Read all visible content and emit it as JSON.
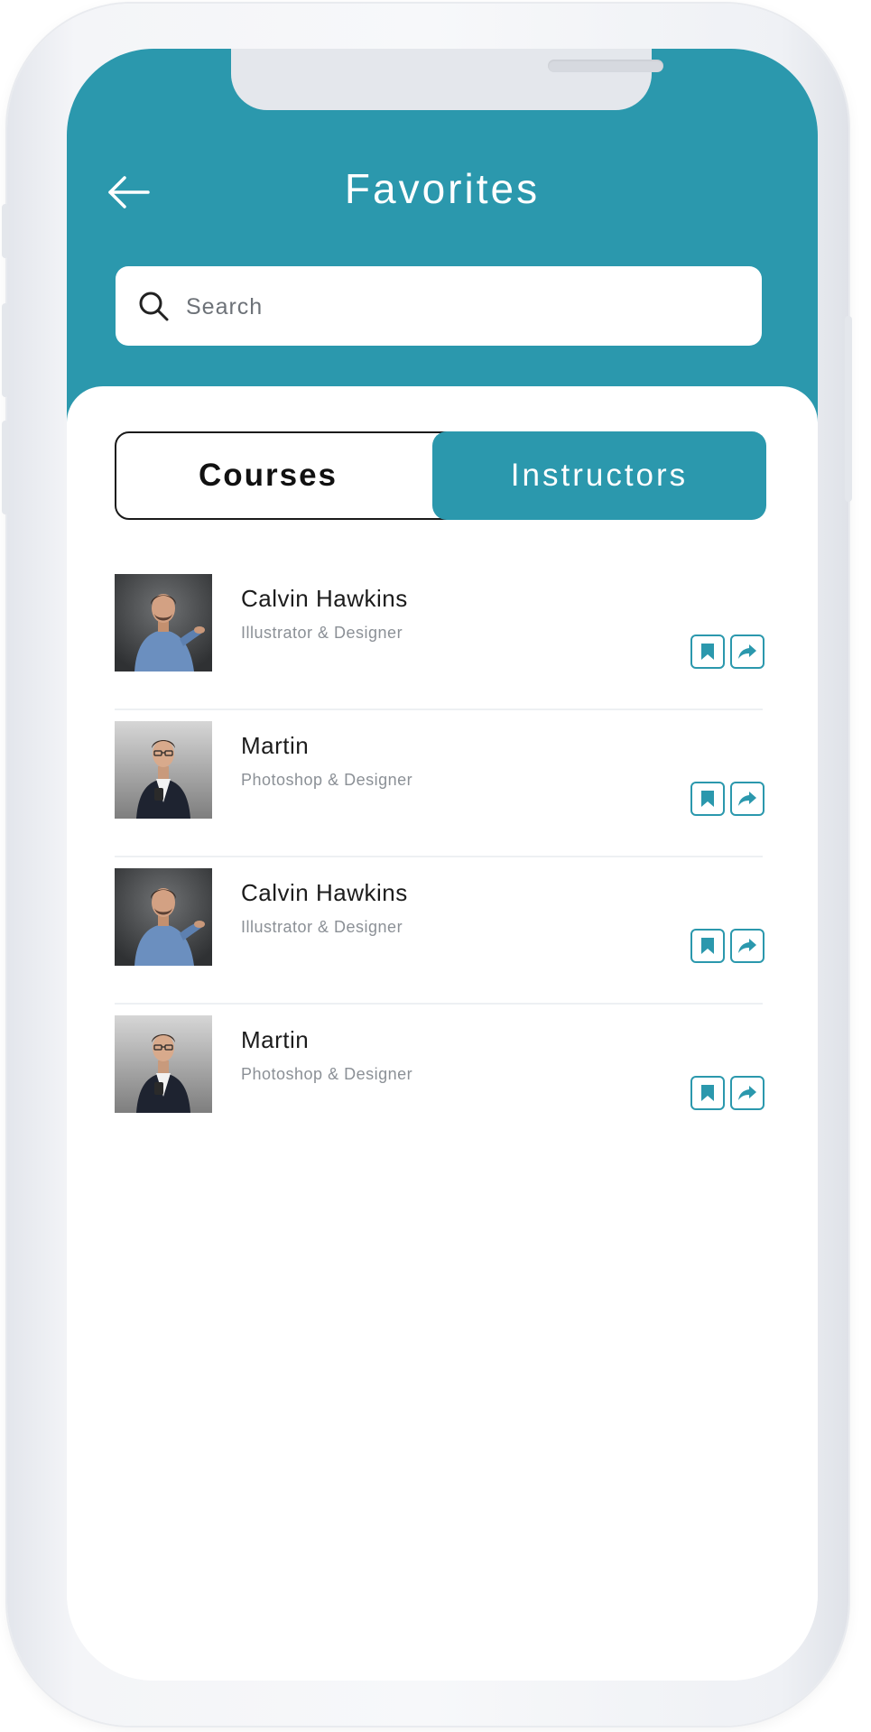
{
  "header": {
    "title": "Favorites",
    "back_icon": "arrow-left-icon"
  },
  "search": {
    "placeholder": "Search",
    "value": "",
    "icon": "search-icon"
  },
  "tabs": [
    {
      "label": "Courses",
      "active": false
    },
    {
      "label": "Instructors",
      "active": true
    }
  ],
  "instructors": [
    {
      "name": "Calvin Hawkins",
      "role": "Illustrator & Designer",
      "avatar": "man-blue-shirt"
    },
    {
      "name": "Martin",
      "role": "Photoshop & Designer",
      "avatar": "man-glasses-blazer"
    },
    {
      "name": "Calvin Hawkins",
      "role": "Illustrator & Designer",
      "avatar": "man-blue-shirt"
    },
    {
      "name": "Martin",
      "role": "Photoshop & Designer",
      "avatar": "man-glasses-blazer"
    }
  ],
  "row_actions": [
    "bookmark-icon",
    "share-icon"
  ],
  "colors": {
    "accent": "#2b98ad",
    "text_primary": "#1c1c1c",
    "text_secondary": "#8b9096"
  }
}
